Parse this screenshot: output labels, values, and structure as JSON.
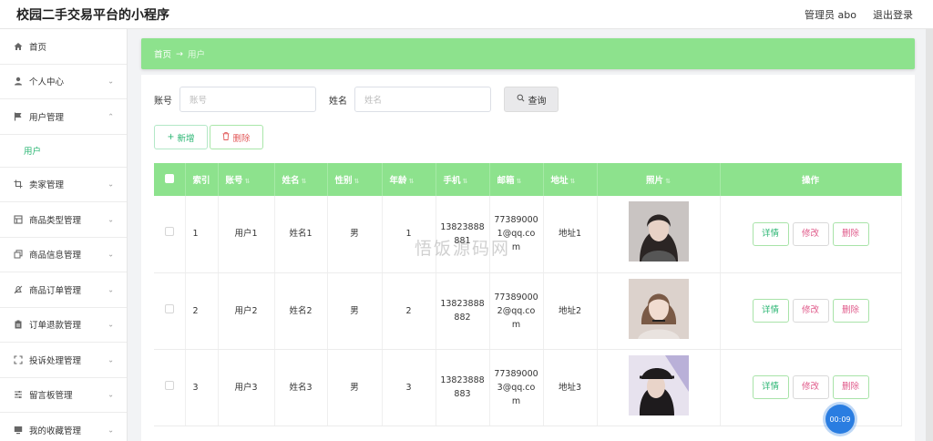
{
  "app": {
    "title": "校园二手交易平台的小程序",
    "admin_label": "管理员 abo",
    "logout_label": "退出登录"
  },
  "sidebar": {
    "items": [
      {
        "label": "首页",
        "icon": "home-icon",
        "has_children": false
      },
      {
        "label": "个人中心",
        "icon": "user-icon",
        "has_children": true
      },
      {
        "label": "用户管理",
        "icon": "flag-icon",
        "has_children": true,
        "expanded": true,
        "children": [
          {
            "label": "用户"
          }
        ]
      },
      {
        "label": "卖家管理",
        "icon": "crop-icon",
        "has_children": true
      },
      {
        "label": "商品类型管理",
        "icon": "grid-icon",
        "has_children": true
      },
      {
        "label": "商品信息管理",
        "icon": "copy-icon",
        "has_children": true
      },
      {
        "label": "商品订单管理",
        "icon": "bell-off-icon",
        "has_children": true
      },
      {
        "label": "订单退款管理",
        "icon": "clipboard-icon",
        "has_children": true
      },
      {
        "label": "投诉处理管理",
        "icon": "frame-icon",
        "has_children": true
      },
      {
        "label": "留言板管理",
        "icon": "sliders-icon",
        "has_children": true
      },
      {
        "label": "我的收藏管理",
        "icon": "monitor-icon",
        "has_children": true
      }
    ]
  },
  "breadcrumb": {
    "home": "首页",
    "arrow": "→",
    "current": "用户"
  },
  "search": {
    "account_label": "账号",
    "account_placeholder": "账号",
    "name_label": "姓名",
    "name_placeholder": "姓名",
    "button_label": "查询"
  },
  "actions": {
    "add_label": "新增",
    "delete_label": "删除"
  },
  "table": {
    "columns": [
      "索引",
      "账号",
      "姓名",
      "性别",
      "年龄",
      "手机",
      "邮箱",
      "地址",
      "照片",
      "操作"
    ],
    "rows": [
      {
        "index": "1",
        "account": "用户1",
        "name": "姓名1",
        "gender": "男",
        "age": "1",
        "phone": "13823888881",
        "email": "773890001@qq.com",
        "address": "地址1"
      },
      {
        "index": "2",
        "account": "用户2",
        "name": "姓名2",
        "gender": "男",
        "age": "2",
        "phone": "13823888882",
        "email": "773890002@qq.com",
        "address": "地址2"
      },
      {
        "index": "3",
        "account": "用户3",
        "name": "姓名3",
        "gender": "男",
        "age": "3",
        "phone": "13823888883",
        "email": "773890003@qq.com",
        "address": "地址3"
      }
    ],
    "row_actions": {
      "detail": "详情",
      "edit": "修改",
      "delete": "删除"
    }
  },
  "watermark": "悟饭源码网",
  "timer": "00:09",
  "colors": {
    "accent_green": "#8de28d",
    "link_green": "#2bb673",
    "danger": "#e25a5a",
    "timer_blue": "#2a7de1"
  }
}
